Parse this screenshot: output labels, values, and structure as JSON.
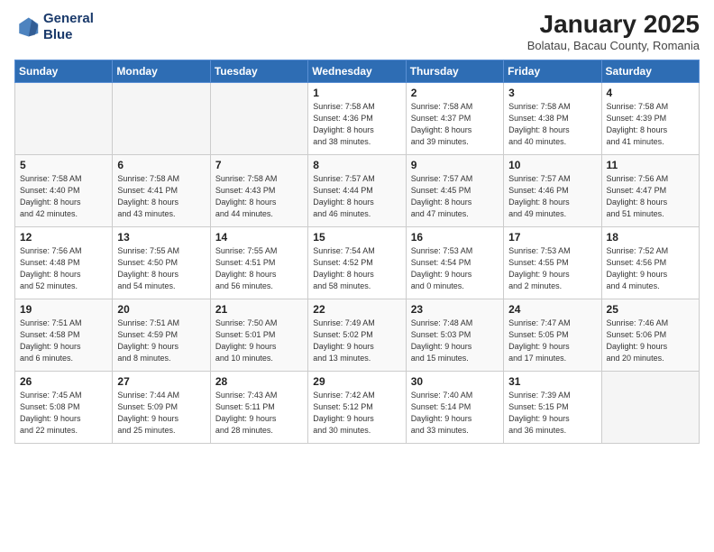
{
  "logo": {
    "line1": "General",
    "line2": "Blue"
  },
  "title": "January 2025",
  "subtitle": "Bolatau, Bacau County, Romania",
  "weekdays": [
    "Sunday",
    "Monday",
    "Tuesday",
    "Wednesday",
    "Thursday",
    "Friday",
    "Saturday"
  ],
  "weeks": [
    [
      {
        "day": "",
        "info": ""
      },
      {
        "day": "",
        "info": ""
      },
      {
        "day": "",
        "info": ""
      },
      {
        "day": "1",
        "info": "Sunrise: 7:58 AM\nSunset: 4:36 PM\nDaylight: 8 hours\nand 38 minutes."
      },
      {
        "day": "2",
        "info": "Sunrise: 7:58 AM\nSunset: 4:37 PM\nDaylight: 8 hours\nand 39 minutes."
      },
      {
        "day": "3",
        "info": "Sunrise: 7:58 AM\nSunset: 4:38 PM\nDaylight: 8 hours\nand 40 minutes."
      },
      {
        "day": "4",
        "info": "Sunrise: 7:58 AM\nSunset: 4:39 PM\nDaylight: 8 hours\nand 41 minutes."
      }
    ],
    [
      {
        "day": "5",
        "info": "Sunrise: 7:58 AM\nSunset: 4:40 PM\nDaylight: 8 hours\nand 42 minutes."
      },
      {
        "day": "6",
        "info": "Sunrise: 7:58 AM\nSunset: 4:41 PM\nDaylight: 8 hours\nand 43 minutes."
      },
      {
        "day": "7",
        "info": "Sunrise: 7:58 AM\nSunset: 4:43 PM\nDaylight: 8 hours\nand 44 minutes."
      },
      {
        "day": "8",
        "info": "Sunrise: 7:57 AM\nSunset: 4:44 PM\nDaylight: 8 hours\nand 46 minutes."
      },
      {
        "day": "9",
        "info": "Sunrise: 7:57 AM\nSunset: 4:45 PM\nDaylight: 8 hours\nand 47 minutes."
      },
      {
        "day": "10",
        "info": "Sunrise: 7:57 AM\nSunset: 4:46 PM\nDaylight: 8 hours\nand 49 minutes."
      },
      {
        "day": "11",
        "info": "Sunrise: 7:56 AM\nSunset: 4:47 PM\nDaylight: 8 hours\nand 51 minutes."
      }
    ],
    [
      {
        "day": "12",
        "info": "Sunrise: 7:56 AM\nSunset: 4:48 PM\nDaylight: 8 hours\nand 52 minutes."
      },
      {
        "day": "13",
        "info": "Sunrise: 7:55 AM\nSunset: 4:50 PM\nDaylight: 8 hours\nand 54 minutes."
      },
      {
        "day": "14",
        "info": "Sunrise: 7:55 AM\nSunset: 4:51 PM\nDaylight: 8 hours\nand 56 minutes."
      },
      {
        "day": "15",
        "info": "Sunrise: 7:54 AM\nSunset: 4:52 PM\nDaylight: 8 hours\nand 58 minutes."
      },
      {
        "day": "16",
        "info": "Sunrise: 7:53 AM\nSunset: 4:54 PM\nDaylight: 9 hours\nand 0 minutes."
      },
      {
        "day": "17",
        "info": "Sunrise: 7:53 AM\nSunset: 4:55 PM\nDaylight: 9 hours\nand 2 minutes."
      },
      {
        "day": "18",
        "info": "Sunrise: 7:52 AM\nSunset: 4:56 PM\nDaylight: 9 hours\nand 4 minutes."
      }
    ],
    [
      {
        "day": "19",
        "info": "Sunrise: 7:51 AM\nSunset: 4:58 PM\nDaylight: 9 hours\nand 6 minutes."
      },
      {
        "day": "20",
        "info": "Sunrise: 7:51 AM\nSunset: 4:59 PM\nDaylight: 9 hours\nand 8 minutes."
      },
      {
        "day": "21",
        "info": "Sunrise: 7:50 AM\nSunset: 5:01 PM\nDaylight: 9 hours\nand 10 minutes."
      },
      {
        "day": "22",
        "info": "Sunrise: 7:49 AM\nSunset: 5:02 PM\nDaylight: 9 hours\nand 13 minutes."
      },
      {
        "day": "23",
        "info": "Sunrise: 7:48 AM\nSunset: 5:03 PM\nDaylight: 9 hours\nand 15 minutes."
      },
      {
        "day": "24",
        "info": "Sunrise: 7:47 AM\nSunset: 5:05 PM\nDaylight: 9 hours\nand 17 minutes."
      },
      {
        "day": "25",
        "info": "Sunrise: 7:46 AM\nSunset: 5:06 PM\nDaylight: 9 hours\nand 20 minutes."
      }
    ],
    [
      {
        "day": "26",
        "info": "Sunrise: 7:45 AM\nSunset: 5:08 PM\nDaylight: 9 hours\nand 22 minutes."
      },
      {
        "day": "27",
        "info": "Sunrise: 7:44 AM\nSunset: 5:09 PM\nDaylight: 9 hours\nand 25 minutes."
      },
      {
        "day": "28",
        "info": "Sunrise: 7:43 AM\nSunset: 5:11 PM\nDaylight: 9 hours\nand 28 minutes."
      },
      {
        "day": "29",
        "info": "Sunrise: 7:42 AM\nSunset: 5:12 PM\nDaylight: 9 hours\nand 30 minutes."
      },
      {
        "day": "30",
        "info": "Sunrise: 7:40 AM\nSunset: 5:14 PM\nDaylight: 9 hours\nand 33 minutes."
      },
      {
        "day": "31",
        "info": "Sunrise: 7:39 AM\nSunset: 5:15 PM\nDaylight: 9 hours\nand 36 minutes."
      },
      {
        "day": "",
        "info": ""
      }
    ]
  ]
}
